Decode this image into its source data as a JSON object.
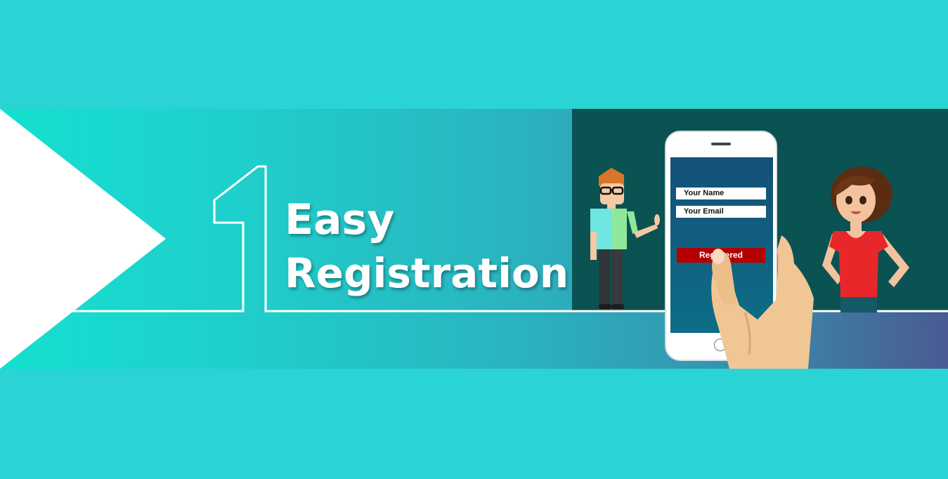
{
  "headline": {
    "line1": "Easy",
    "line2": "Registration"
  },
  "phone": {
    "name_field": "Your Name",
    "email_field": "Your Email",
    "button_label": "Registered"
  },
  "colors": {
    "page_background": "#2ad4d4",
    "dark_panel": "#0a5352",
    "button": "#b50000",
    "screen": "#145079"
  },
  "icons": [
    "step-number-one-outline",
    "man-with-glasses-character",
    "woman-character",
    "smartphone",
    "hand-holding-phone"
  ]
}
